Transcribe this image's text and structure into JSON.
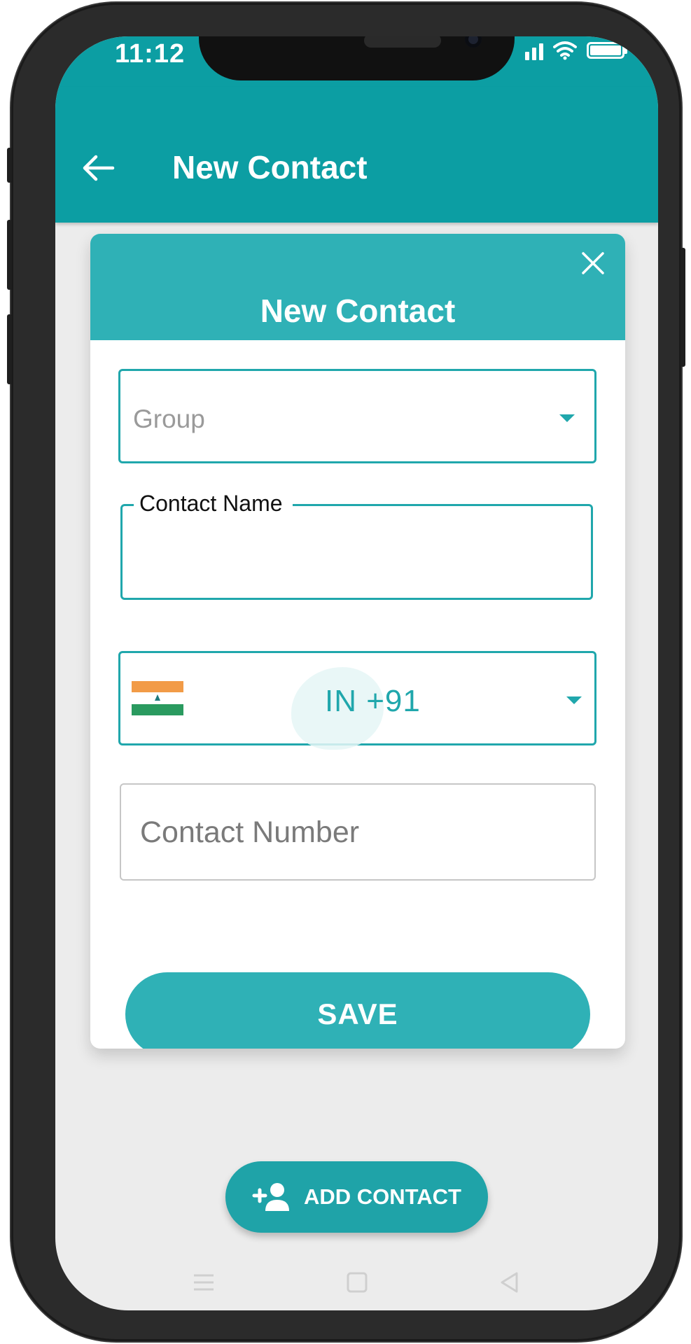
{
  "status_bar": {
    "time": "11:12",
    "icons": [
      "signal-icon",
      "wifi-icon",
      "battery-icon"
    ]
  },
  "app_bar": {
    "title": "New Contact",
    "back_icon": "arrow-left-icon"
  },
  "dialog": {
    "title": "New Contact",
    "close_icon": "close-icon",
    "group_select": {
      "placeholder": "Group",
      "value": ""
    },
    "contact_name": {
      "label": "Contact Name",
      "value": ""
    },
    "country_code": {
      "flag": "india-flag-icon",
      "value": "IN +91"
    },
    "contact_number": {
      "placeholder": "Contact Number",
      "value": ""
    },
    "save_label": "SAVE"
  },
  "fab": {
    "label": "ADD CONTACT",
    "icon": "add-person-icon"
  },
  "nav_bar": {
    "items": [
      "menu-icon",
      "home-square-icon",
      "back-triangle-icon"
    ]
  },
  "colors": {
    "primary": "#0c9ea3",
    "dialog_header": "#2fb1b6",
    "accent": "#20a7ac",
    "background": "#ececec"
  }
}
